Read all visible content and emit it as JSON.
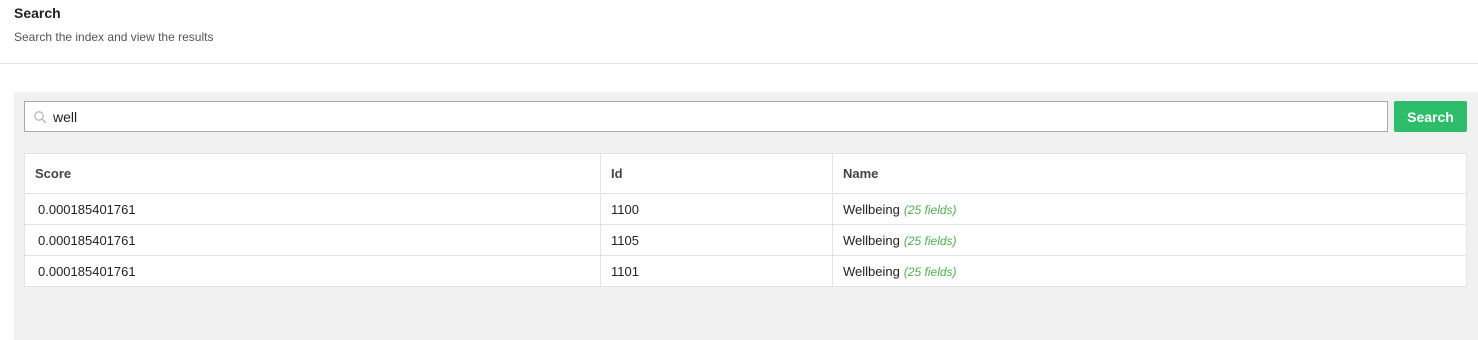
{
  "header": {
    "title": "Search",
    "subtitle": "Search the index and view the results"
  },
  "search": {
    "value": "well",
    "button_label": "Search",
    "icon": "search-icon"
  },
  "table": {
    "columns": [
      "Score",
      "Id",
      "Name"
    ],
    "rows": [
      {
        "score": "0.000185401761",
        "id": "1100",
        "name": "Wellbeing",
        "fields": "(25 fields)"
      },
      {
        "score": "0.000185401761",
        "id": "1105",
        "name": "Wellbeing",
        "fields": "(25 fields)"
      },
      {
        "score": "0.000185401761",
        "id": "1101",
        "name": "Wellbeing",
        "fields": "(25 fields)"
      }
    ]
  },
  "colors": {
    "accent": "#2ebd6b",
    "fields_note": "#4caf50",
    "panel_bg": "#f1f1f2"
  }
}
